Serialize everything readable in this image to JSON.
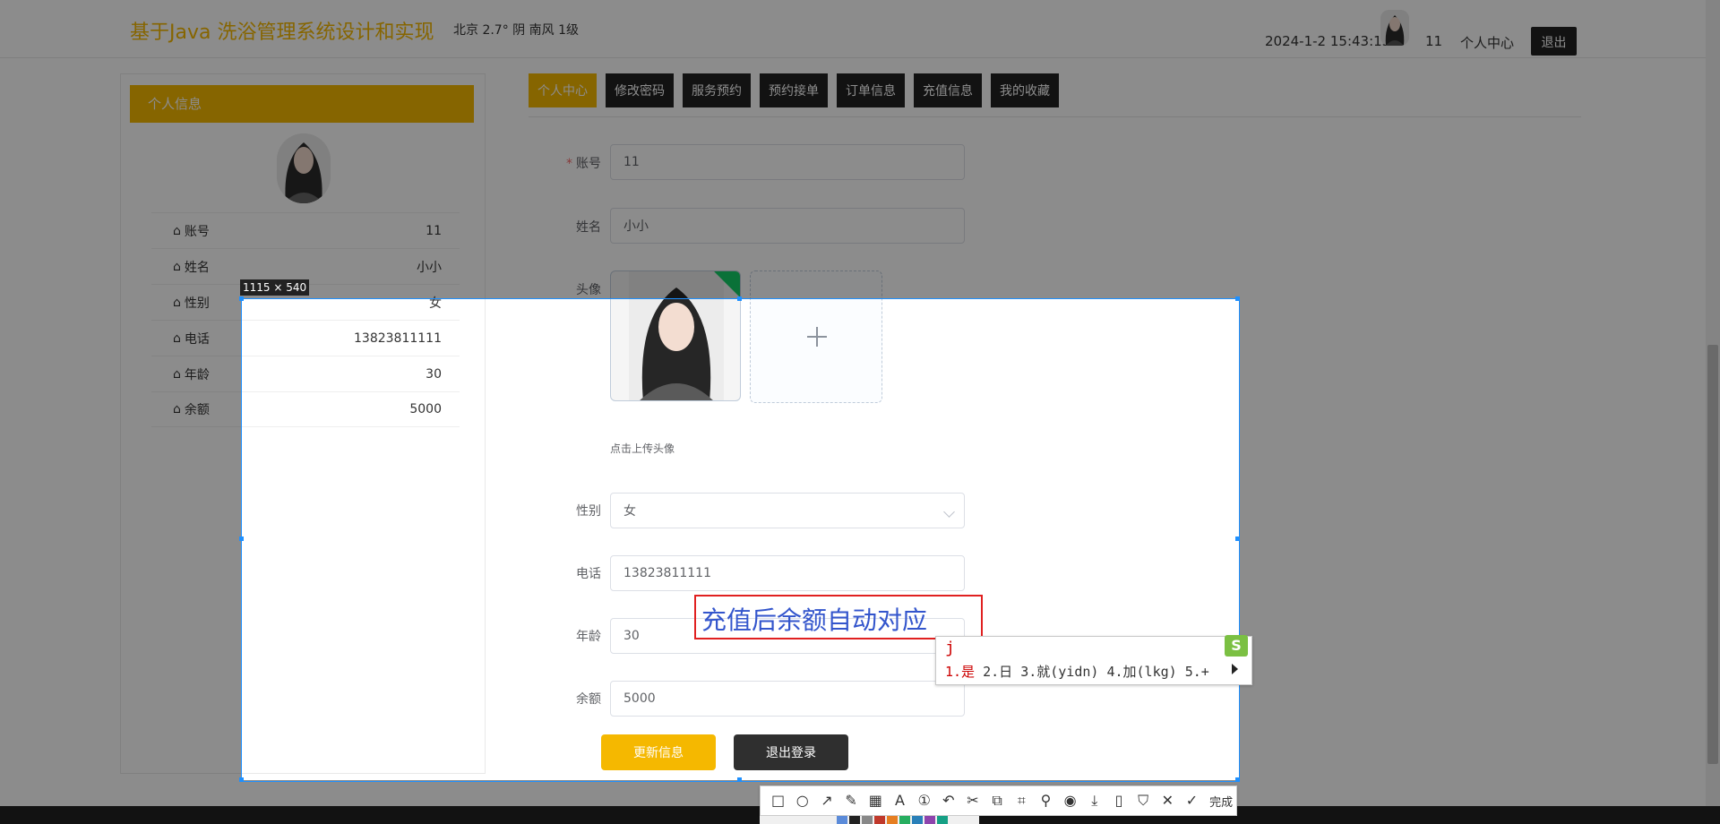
{
  "header": {
    "site_title": "基于Java 洗浴管理系统设计和实现",
    "weather": "北京  2.7°  阴  南风  1级",
    "datetime": "2024-1-2 15:43:13",
    "username": "11",
    "center_label": "个人中心",
    "logout_label": "退出"
  },
  "sidebar": {
    "title": "个人信息",
    "rows": [
      {
        "key": "账号",
        "value": "11"
      },
      {
        "key": "姓名",
        "value": "小小"
      },
      {
        "key": "性别",
        "value": "女"
      },
      {
        "key": "电话",
        "value": "13823811111"
      },
      {
        "key": "年龄",
        "value": "30"
      },
      {
        "key": "余额",
        "value": "5000"
      }
    ]
  },
  "tabs": [
    "个人中心",
    "修改密码",
    "服务预约",
    "预约接单",
    "订单信息",
    "充值信息",
    "我的收藏"
  ],
  "form": {
    "account": {
      "label": "账号",
      "value": "11"
    },
    "name": {
      "label": "姓名",
      "value": "小小"
    },
    "avatar": {
      "label": "头像",
      "tip": "点击上传头像"
    },
    "gender": {
      "label": "性别",
      "value": "女"
    },
    "phone": {
      "label": "电话",
      "value": "13823811111"
    },
    "age": {
      "label": "年龄",
      "value": "30"
    },
    "balance": {
      "label": "余额",
      "value": "5000"
    },
    "update_button": "更新信息",
    "logout_button": "退出登录"
  },
  "screenshot_tool": {
    "size_label": "1115 × 540",
    "annotation": "充值后余额自动对应",
    "ime_input": "j",
    "ime_candidates": [
      "1.是",
      "2.日",
      "3.就(yidn)",
      "4.加(lkg)",
      "5.+"
    ],
    "ime_logo": "S",
    "done_label": "完成",
    "tools": [
      {
        "name": "rectangle-tool-icon",
        "glyph": "□"
      },
      {
        "name": "ellipse-tool-icon",
        "glyph": "○"
      },
      {
        "name": "arrow-tool-icon",
        "glyph": "↗"
      },
      {
        "name": "pen-tool-icon",
        "glyph": "✎"
      },
      {
        "name": "mosaic-tool-icon",
        "glyph": "▦"
      },
      {
        "name": "text-tool-icon",
        "glyph": "A"
      },
      {
        "name": "number-tool-icon",
        "glyph": "①"
      },
      {
        "name": "undo-icon",
        "glyph": "↶"
      },
      {
        "name": "scissors-icon",
        "glyph": "✂"
      },
      {
        "name": "copy-icon",
        "glyph": "⧉"
      },
      {
        "name": "scan-icon",
        "glyph": "⌗"
      },
      {
        "name": "pin-icon",
        "glyph": "⚲"
      },
      {
        "name": "record-icon",
        "glyph": "◉"
      },
      {
        "name": "download-icon",
        "glyph": "⤓"
      },
      {
        "name": "phone-icon",
        "glyph": "▯"
      },
      {
        "name": "bookmark-icon",
        "glyph": "⛉"
      },
      {
        "name": "close-icon",
        "glyph": "✕"
      },
      {
        "name": "check-icon",
        "glyph": "✓"
      }
    ],
    "palette": [
      "#5b8bd9",
      "#222222",
      "#888888",
      "#c0392b",
      "#e67e22",
      "#27ae60",
      "#2980b9",
      "#8e44ad",
      "#16a085"
    ]
  },
  "colors": {
    "accent": "#f5b800",
    "dark_button": "#222222",
    "selection_border": "#1e90ff"
  }
}
